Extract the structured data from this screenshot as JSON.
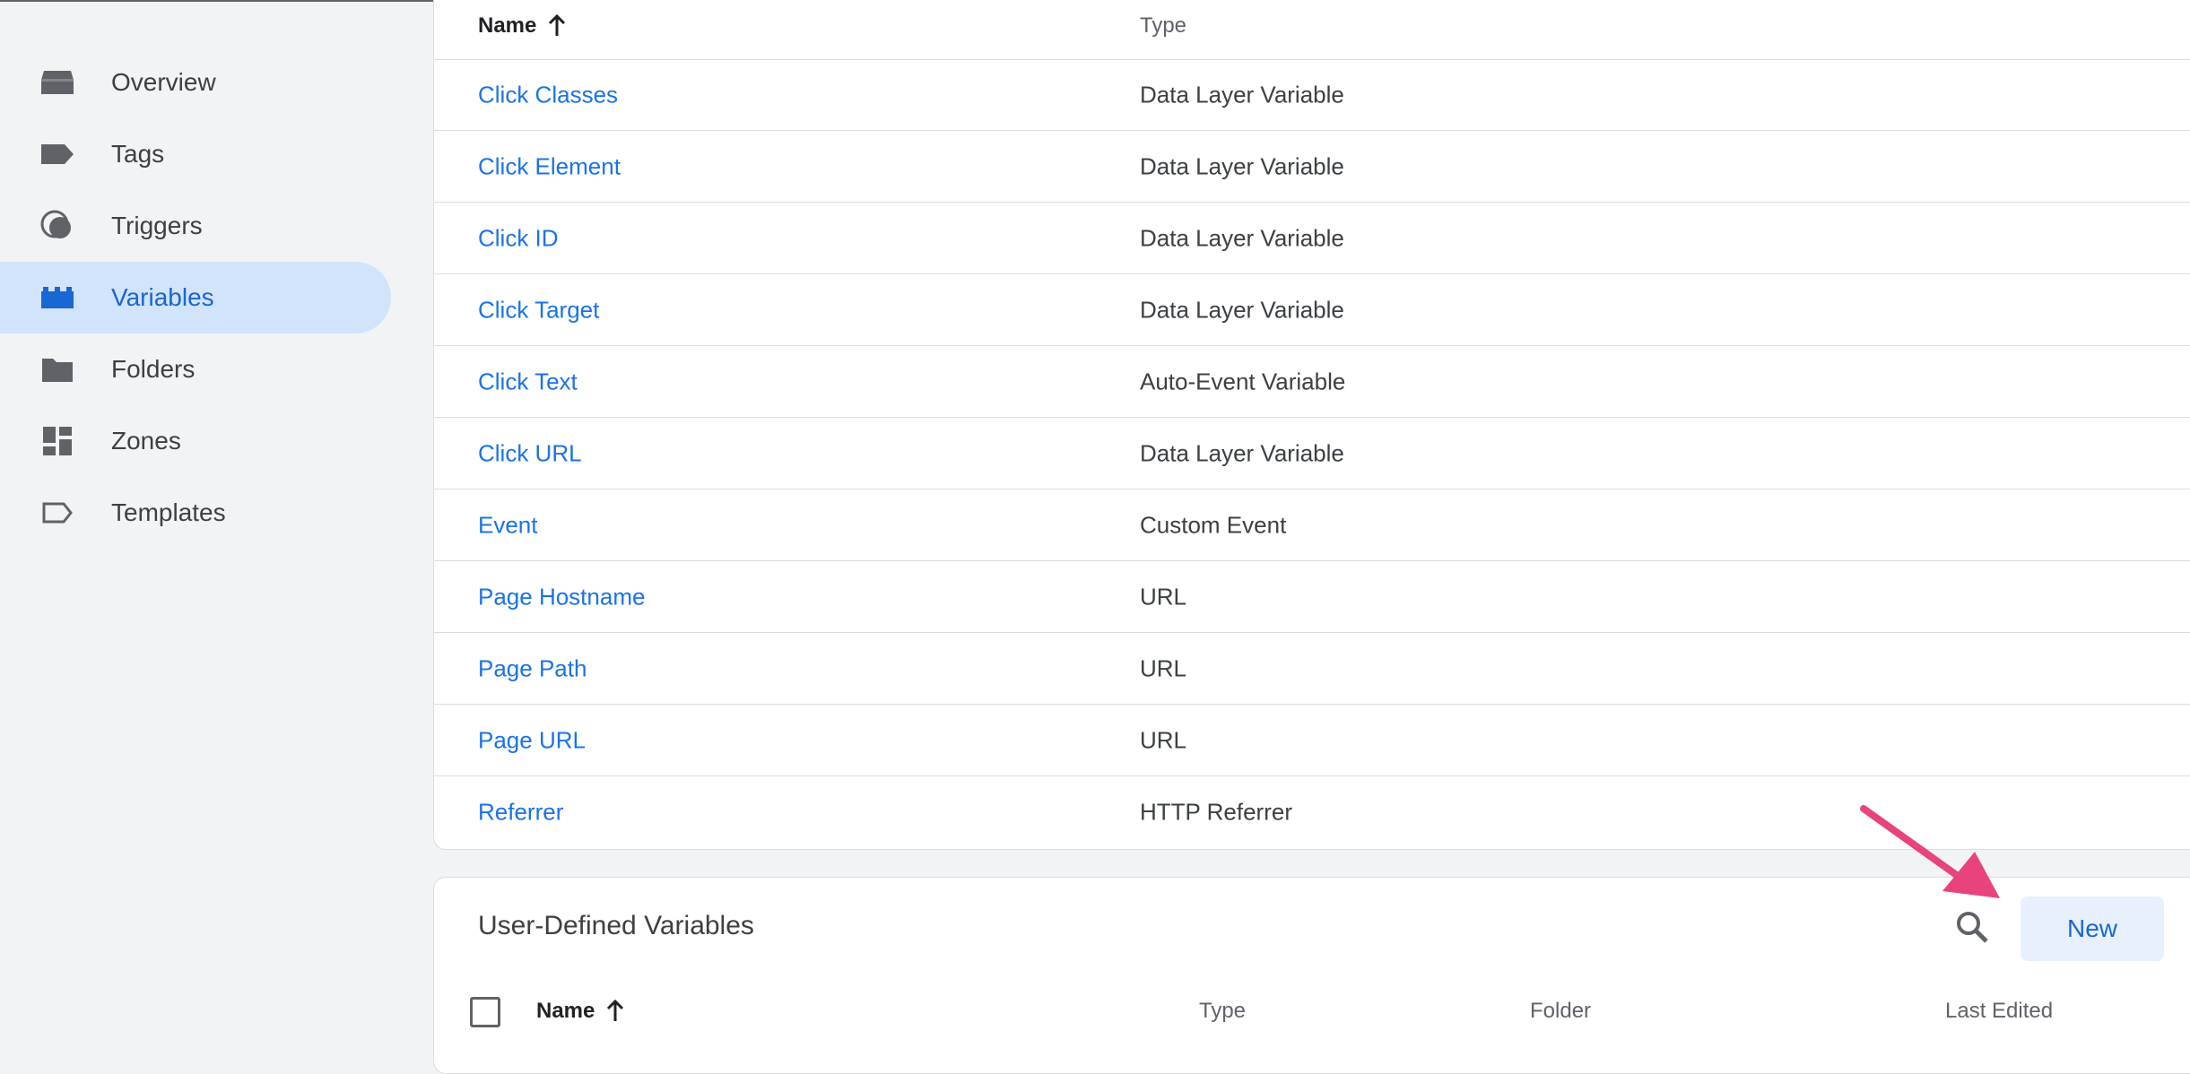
{
  "sidebar": {
    "items": [
      {
        "label": "Overview",
        "icon": "overview-icon"
      },
      {
        "label": "Tags",
        "icon": "tag-icon"
      },
      {
        "label": "Triggers",
        "icon": "trigger-icon"
      },
      {
        "label": "Variables",
        "icon": "variables-icon",
        "active": true
      },
      {
        "label": "Folders",
        "icon": "folder-icon"
      },
      {
        "label": "Zones",
        "icon": "zones-icon"
      },
      {
        "label": "Templates",
        "icon": "templates-icon"
      }
    ]
  },
  "builtin": {
    "header": {
      "name": "Name",
      "type": "Type"
    },
    "rows": [
      {
        "name": "Click Classes",
        "type": "Data Layer Variable"
      },
      {
        "name": "Click Element",
        "type": "Data Layer Variable"
      },
      {
        "name": "Click ID",
        "type": "Data Layer Variable"
      },
      {
        "name": "Click Target",
        "type": "Data Layer Variable"
      },
      {
        "name": "Click Text",
        "type": "Auto-Event Variable"
      },
      {
        "name": "Click URL",
        "type": "Data Layer Variable"
      },
      {
        "name": "Event",
        "type": "Custom Event"
      },
      {
        "name": "Page Hostname",
        "type": "URL"
      },
      {
        "name": "Page Path",
        "type": "URL"
      },
      {
        "name": "Page URL",
        "type": "URL"
      },
      {
        "name": "Referrer",
        "type": "HTTP Referrer"
      }
    ]
  },
  "user_defined": {
    "title": "User-Defined Variables",
    "new_label": "New",
    "columns": {
      "name": "Name",
      "type": "Type",
      "folder": "Folder",
      "last_edited": "Last Edited"
    }
  },
  "colors": {
    "accent": "#1a73e8",
    "active_bg": "#d2e3fc",
    "annotation_arrow": "#e8437f"
  }
}
